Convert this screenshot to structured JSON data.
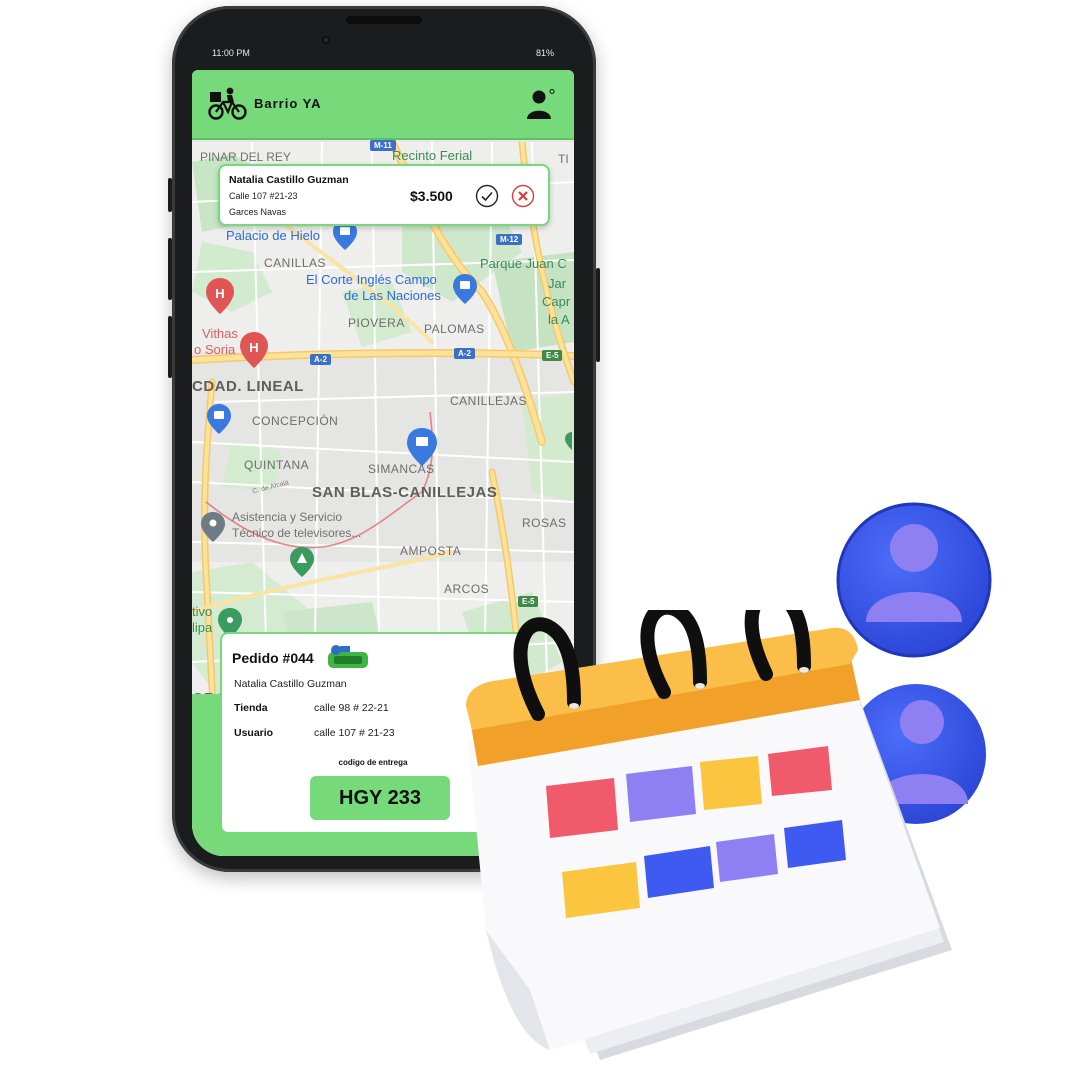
{
  "status_bar": {
    "time": "11:00 PM",
    "battery": "81%"
  },
  "app": {
    "brand": "Barrio YA"
  },
  "notification": {
    "customer_name": "Natalia Castillo Guzman",
    "address": "Calle 107 #21-23",
    "neighborhood": "Garces Navas",
    "price": "$3.500"
  },
  "order": {
    "title": "Pedido #044",
    "customer_name": "Natalia Castillo Guzman",
    "store_label": "Tienda",
    "store_address": "calle 98 # 22-21",
    "user_label": "Usuario",
    "user_address": "calle 107 # 21-23",
    "code_label": "codigo de entrega",
    "delivery_code": "HGY 233"
  },
  "map": {
    "labels": {
      "pinar": "PINAR DEL REY",
      "recinto": "Recinto Ferial",
      "ti": "TI",
      "palacio": "Palacio de Hielo",
      "canillas": "CANILLAS",
      "corte1": "El Corte Inglés Campo",
      "corte2": "de Las Naciones",
      "parque": "Parque Juan C",
      "jar": "Jar",
      "capr": "Capr",
      "la": "la A",
      "piovera": "PIOVERA",
      "palomas": "PALOMAS",
      "vithas": "Vithas",
      "soria": "o Soria",
      "ciudad": "CDAD. LINEAL",
      "canillejas": "CANILLEJAS",
      "concepcion": "CONCEPCIÓN",
      "quintana": "QUINTANA",
      "simancas": "SIMANCAS",
      "alcala": "C. de Alcalá",
      "sanblas": "SAN BLAS-CANILLEJAS",
      "asistencia1": "Asistencia y Servicio",
      "asistencia2": "Técnico de televisores...",
      "rosas": "ROSAS",
      "amposta": "AMPOSTA",
      "arcos": "ARCOS",
      "tivo": "tivo",
      "lipa": "lipa",
      "ora": "ORA"
    },
    "shields": {
      "m11": "M-11",
      "m12": "M-12",
      "a2a": "A-2",
      "a2b": "A-2",
      "e5a": "E-5",
      "e5b": "E-5"
    }
  },
  "colors": {
    "brand_green": "#76d97a",
    "map_background": "#eeeeec",
    "calendar_top": "#f8b43a",
    "user_circle": "#3557e0",
    "user_figure": "#8e7ff0"
  },
  "icons": [
    "delivery-bike-icon",
    "user-icon",
    "check-icon",
    "close-icon",
    "hospital-pin-icon",
    "shopping-pin-icon",
    "location-pin-icon",
    "park-pin-icon",
    "calendar-icon",
    "user-avatar-icon"
  ]
}
